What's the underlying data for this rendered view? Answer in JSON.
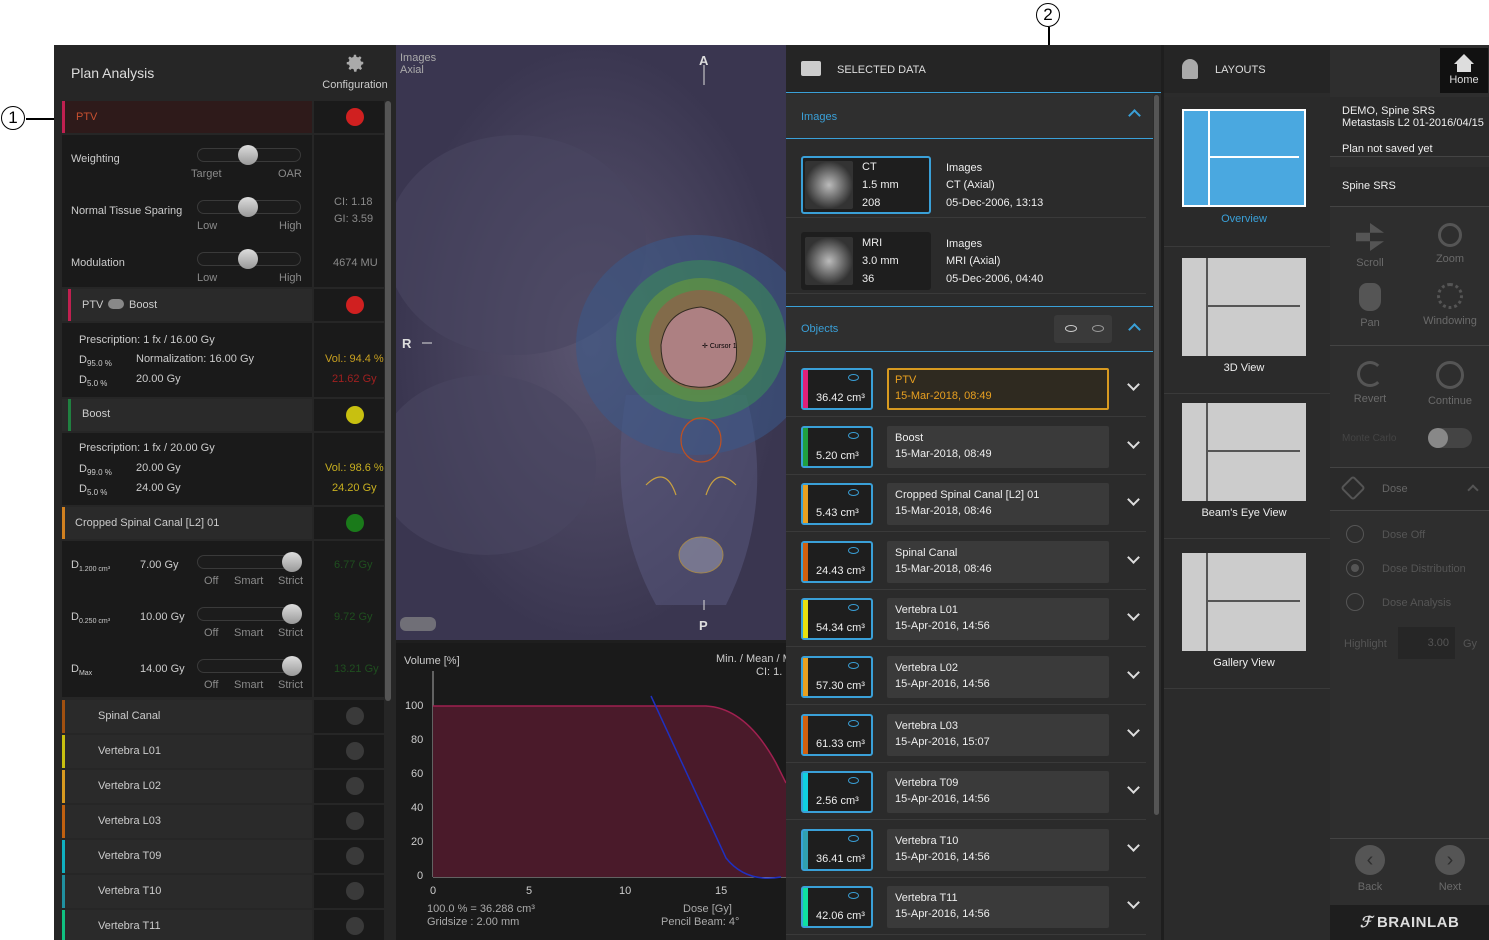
{
  "callouts": [
    "1",
    "2"
  ],
  "left_panel": {
    "title": "Plan Analysis",
    "config_label": "Configuration",
    "ptv_label": "PTV",
    "weighting": {
      "label": "Weighting",
      "left": "Target",
      "right": "OAR",
      "level": 0.5
    },
    "nts": {
      "label": "Normal Tissue Sparing",
      "left": "Low",
      "right": "High",
      "level": 0.5,
      "ci": "CI:  1.18",
      "gi": "GI:  3.59"
    },
    "modulation": {
      "label": "Modulation",
      "left": "Low",
      "right": "High",
      "level": 0.5,
      "mu": "4674 MU"
    },
    "ptv_boost": {
      "label_a": "PTV",
      "label_b": "Boost",
      "color": "#d02020"
    },
    "ptv_rx": {
      "prescription": "Prescription: 1 fx / 16.00 Gy",
      "d1": "D",
      "d1_sub": "95.0 %",
      "d1_val": "Normalization: 16.00 Gy",
      "d2": "D",
      "d2_sub": "5.0 %",
      "d2_val": "20.00 Gy",
      "vol": "Vol.: 94.4 %",
      "max": "21.62 Gy"
    },
    "boost": {
      "label": "Boost",
      "color": "#c8c010"
    },
    "boost_rx": {
      "prescription": "Prescription: 1 fx / 20.00 Gy",
      "d1": "D",
      "d1_sub": "99.0 %",
      "d1_val": "20.00 Gy",
      "d2": "D",
      "d2_sub": "5.0 %",
      "d2_val": "24.00 Gy",
      "vol": "Vol.: 98.6 %",
      "max": "24.20 Gy"
    },
    "canal": {
      "label": "Cropped Spinal Canal [L2] 01",
      "color": "#1a8a1a"
    },
    "constraints": [
      {
        "d": "D",
        "sub": "1.200 cm³",
        "val": "7.00 Gy",
        "result": "6.77 Gy",
        "opts": [
          "Off",
          "Smart",
          "Strict"
        ]
      },
      {
        "d": "D",
        "sub": "0.250 cm³",
        "val": "10.00 Gy",
        "result": "9.72 Gy",
        "opts": [
          "Off",
          "Smart",
          "Strict"
        ]
      },
      {
        "d": "D",
        "sub": "Max",
        "val": "14.00 Gy",
        "result": "13.21 Gy",
        "opts": [
          "Off",
          "Smart",
          "Strict"
        ]
      }
    ],
    "structures": [
      {
        "label": "Spinal Canal",
        "color": "#a05010"
      },
      {
        "label": "Vertebra L01",
        "color": "#c8c010"
      },
      {
        "label": "Vertebra L02",
        "color": "#d89a20"
      },
      {
        "label": "Vertebra L03",
        "color": "#c06010"
      },
      {
        "label": "Vertebra T09",
        "color": "#10b0c0"
      },
      {
        "label": "Vertebra T10",
        "color": "#2090a0"
      },
      {
        "label": "Vertebra T11",
        "color": "#10c080"
      }
    ]
  },
  "viewer": {
    "line1": "Images",
    "line2": "Axial",
    "top": "A",
    "bottom": "P",
    "left": "R",
    "marker": "Cursor 1"
  },
  "dvh": {
    "ylabel": "Volume [%]",
    "yticks": [
      "100",
      "80",
      "60",
      "40",
      "20",
      "0"
    ],
    "xticks": [
      "0",
      "5",
      "10",
      "15"
    ],
    "legend_a": "Min. / Mean / M",
    "legend_b": "CI: 1.",
    "foot_a": "100.0 % = 36.288 cm³",
    "foot_b": "Gridsize : 2.00 mm",
    "foot_c": "Dose [Gy]",
    "foot_d": "Pencil Beam: 4°"
  },
  "selected_data": {
    "title": "SELECTED DATA",
    "images_header": "Images",
    "images": [
      {
        "mod": "CT",
        "slice": "1.5 mm",
        "count": "208",
        "type": "Images",
        "desc": "CT (Axial)",
        "date": "05-Dec-2006, 13:13"
      },
      {
        "mod": "MRI",
        "slice": "3.0 mm",
        "count": "36",
        "type": "Images",
        "desc": "MRI (Axial)",
        "date": "05-Dec-2006, 04:40"
      }
    ],
    "objects_header": "Objects",
    "objects": [
      {
        "vol": "36.42 cm³",
        "name": "PTV",
        "date": "15-Mar-2018, 08:49",
        "color": "#e0207a"
      },
      {
        "vol": "5.20 cm³",
        "name": "Boost",
        "date": "15-Mar-2018, 08:49",
        "color": "#20a040"
      },
      {
        "vol": "5.43 cm³",
        "name": "Cropped Spinal Canal [L2] 01",
        "date": "15-Mar-2018, 08:46",
        "color": "#e8a020"
      },
      {
        "vol": "24.43 cm³",
        "name": "Spinal Canal",
        "date": "15-Mar-2018, 08:46",
        "color": "#d06010"
      },
      {
        "vol": "54.34 cm³",
        "name": "Vertebra L01",
        "date": "15-Apr-2016, 14:56",
        "color": "#e8e010"
      },
      {
        "vol": "57.30 cm³",
        "name": "Vertebra L02",
        "date": "15-Apr-2016, 14:56",
        "color": "#e8a020"
      },
      {
        "vol": "61.33 cm³",
        "name": "Vertebra L03",
        "date": "15-Apr-2016, 15:07",
        "color": "#d06010"
      },
      {
        "vol": "2.56 cm³",
        "name": "Vertebra T09",
        "date": "15-Apr-2016, 14:56",
        "color": "#10d0e0"
      },
      {
        "vol": "36.41 cm³",
        "name": "Vertebra T10",
        "date": "15-Apr-2016, 14:56",
        "color": "#30a0b0"
      },
      {
        "vol": "42.06 cm³",
        "name": "Vertebra T11",
        "date": "15-Apr-2016, 14:56",
        "color": "#10e0a0"
      }
    ]
  },
  "layouts": {
    "title": "LAYOUTS",
    "items": [
      "Overview",
      "3D View",
      "Beam's Eye View",
      "Gallery View"
    ]
  },
  "right_panel": {
    "home": "Home",
    "plan_a": "DEMO, Spine SRS",
    "plan_b": "Metastasis L2 01-2016/04/15",
    "saved": "Plan not saved yet",
    "plan_type": "Spine SRS",
    "tools": [
      "Scroll",
      "Zoom",
      "Pan",
      "Windowing"
    ],
    "revert": "Revert",
    "continue": "Continue",
    "monte": "Monte Carlo",
    "dose_header": "Dose",
    "dose_opts": [
      "Dose Off",
      "Dose Distribution",
      "Dose Analysis"
    ],
    "highlight": "Highlight",
    "highlight_val": "3.00",
    "highlight_unit": "Gy",
    "back": "Back",
    "next": "Next",
    "brand": "BRAINLAB"
  }
}
